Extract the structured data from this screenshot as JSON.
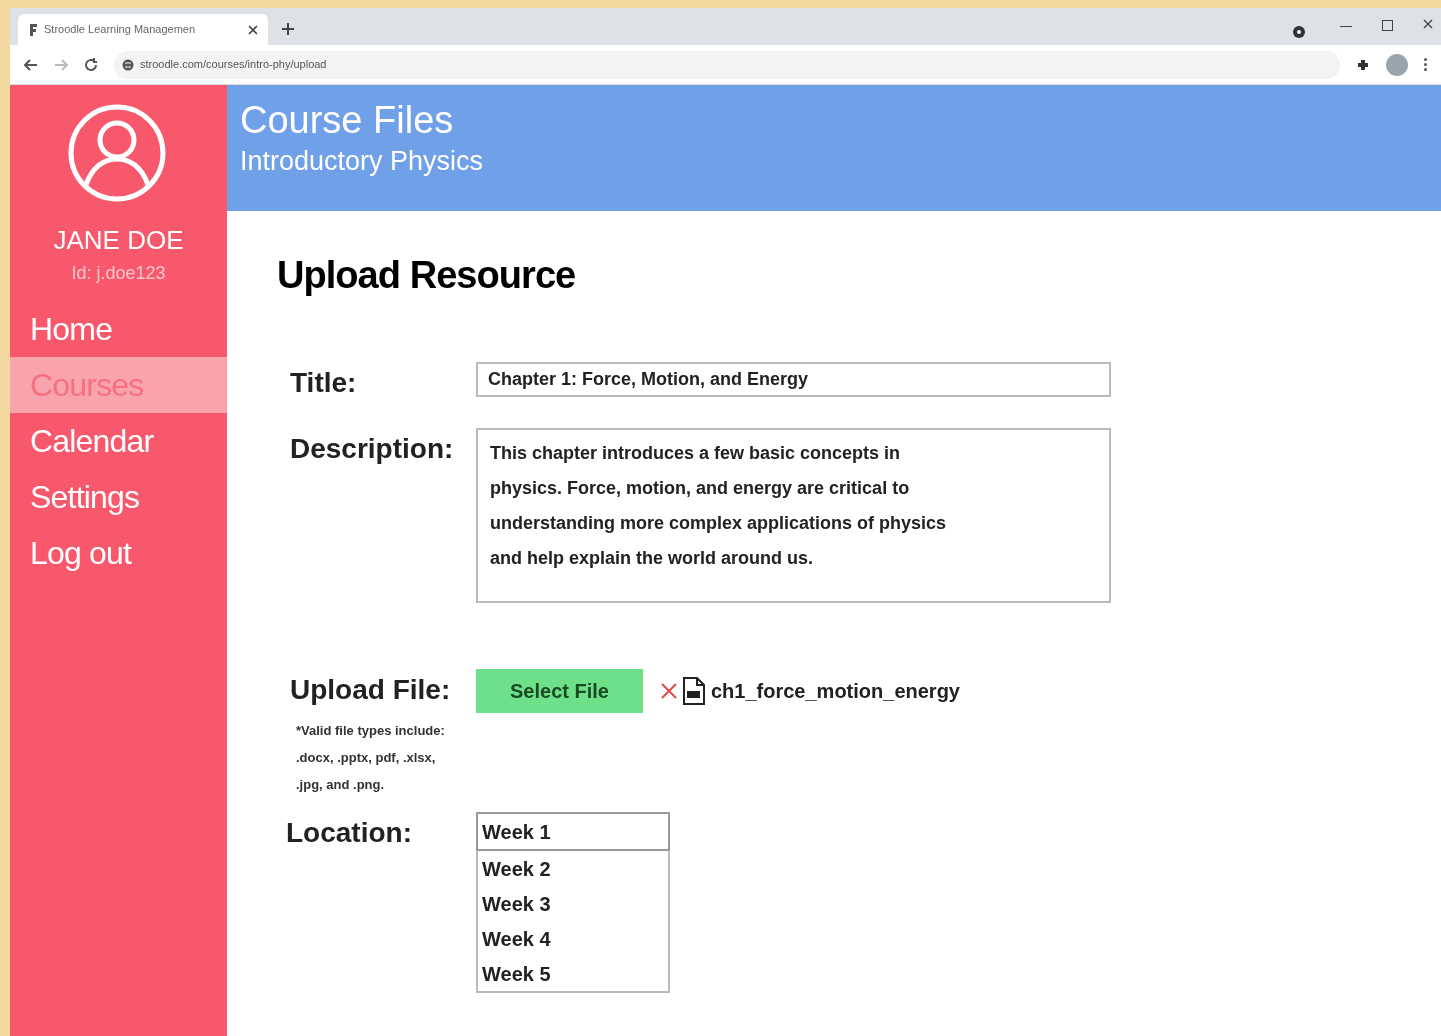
{
  "browser": {
    "tab_title": "Stroodle Learning Managemen",
    "url": "stroodle.com/courses/intro-phy/upload"
  },
  "sidebar": {
    "user_name": "JANE DOE",
    "user_id": "Id: j.doe123",
    "items": [
      {
        "label": "Home",
        "selected": false
      },
      {
        "label": "Courses",
        "selected": true
      },
      {
        "label": "Calendar",
        "selected": false
      },
      {
        "label": "Settings",
        "selected": false
      },
      {
        "label": "Log out",
        "selected": false
      }
    ]
  },
  "header": {
    "title": "Course Files",
    "subtitle": "Introductory Physics"
  },
  "form": {
    "heading": "Upload Resource",
    "title_label": "Title:",
    "title_value": "Chapter 1: Force, Motion, and Energy",
    "description_label": "Description:",
    "description_value": "This chapter introduces a few basic concepts in physics. Force, motion, and energy are critical to understanding more complex applications of physics and help explain the world around us.",
    "upload_label": "Upload File:",
    "upload_note": "*Valid file types include: .docx, .pptx, pdf, .xlsx,  .jpg, and .png.",
    "select_button": "Select File",
    "file_name": "ch1_force_motion_energy",
    "location_label": "Location:",
    "location_value": "Week 1",
    "location_options": [
      "Week 2",
      "Week 3",
      "Week 4",
      "Week 5"
    ]
  }
}
